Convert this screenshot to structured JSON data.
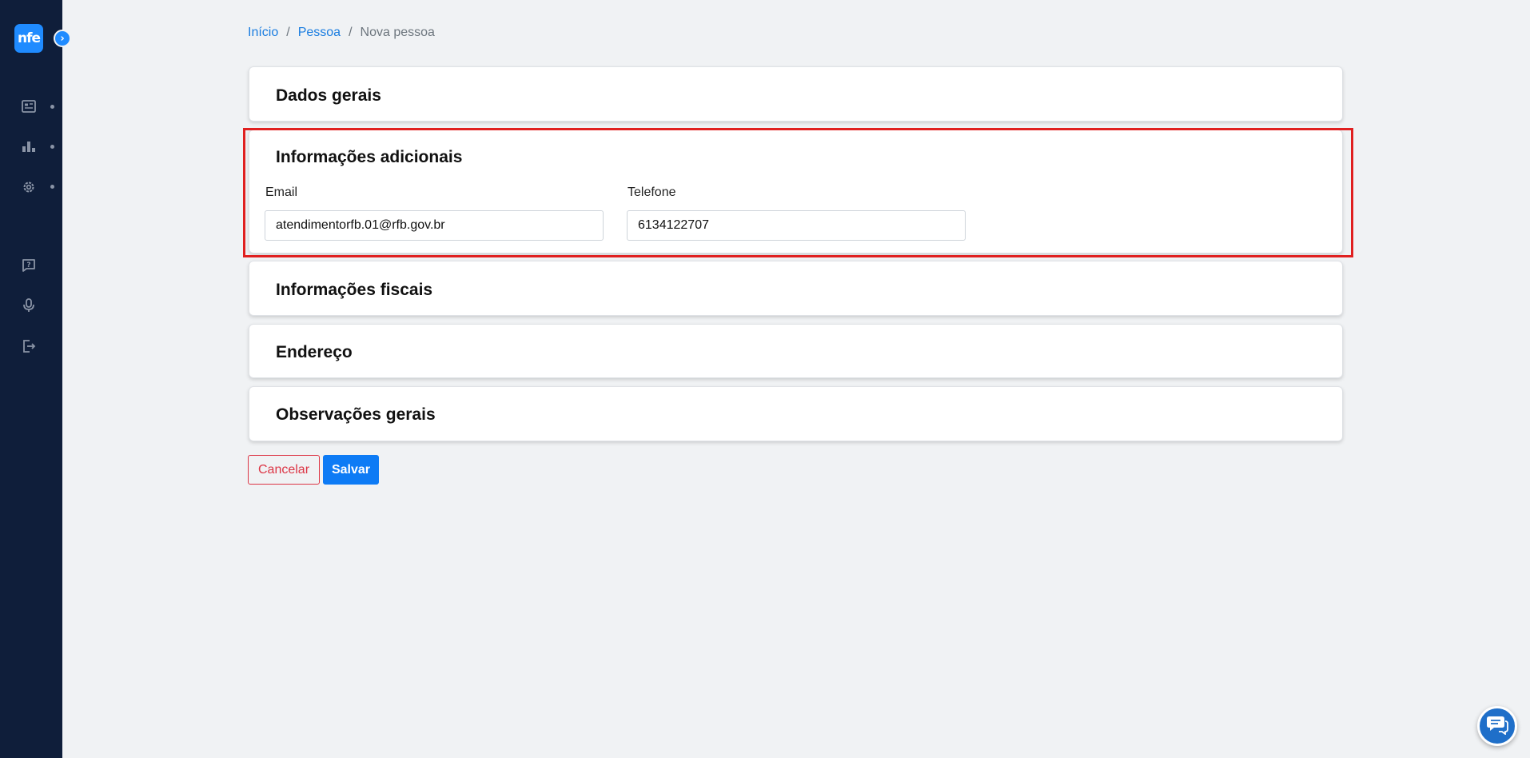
{
  "sidebar": {
    "logo_text": "nfe",
    "expand_glyph": "›",
    "items": [
      {
        "name": "document-icon"
      },
      {
        "name": "chart-icon"
      },
      {
        "name": "gear-icon"
      },
      {
        "name": "help-chat-icon"
      },
      {
        "name": "microphone-icon"
      },
      {
        "name": "logout-icon"
      }
    ]
  },
  "breadcrumb": {
    "home": "Início",
    "parent": "Pessoa",
    "current": "Nova pessoa",
    "separator": "/"
  },
  "sections": {
    "general": "Dados gerais",
    "additional": "Informações adicionais",
    "fiscal": "Informações fiscais",
    "address": "Endereço",
    "notes": "Observações gerais"
  },
  "form": {
    "email_label": "Email",
    "email_value": "atendimentorfb.01@rfb.gov.br",
    "phone_label": "Telefone",
    "phone_value": "6134122707"
  },
  "actions": {
    "cancel_label": "Cancelar",
    "save_label": "Salvar"
  },
  "colors": {
    "sidebar_bg": "#0f1e3a",
    "accent": "#1f8bff",
    "danger": "#dc3545",
    "highlight": "#e02020"
  }
}
